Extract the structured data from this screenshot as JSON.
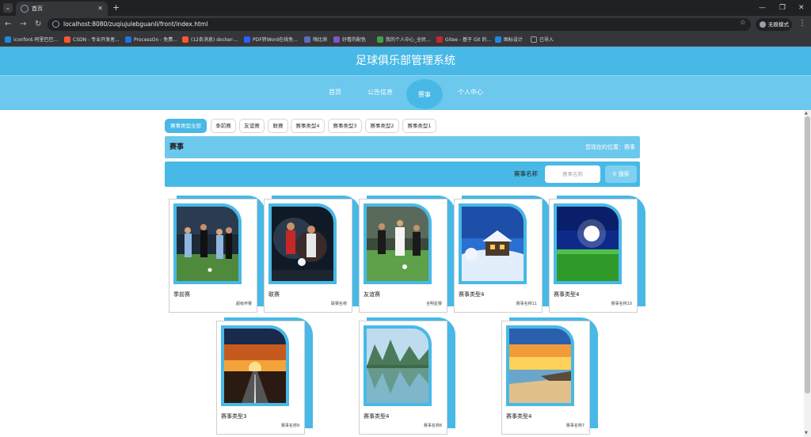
{
  "browser": {
    "tab_title": "首页",
    "url": "localhost:8080/zuqiujulebguanli/front/index.html",
    "incognito_label": "无痕模式",
    "bookmarks": [
      {
        "label": "iconfont-阿里巴巴...",
        "color": "#1e88e5"
      },
      {
        "label": "CSDN - 专业开发者...",
        "color": "#fc5531"
      },
      {
        "label": "ProcessOn - 免费...",
        "color": "#1a73e8"
      },
      {
        "label": "(12条消息) docker-...",
        "color": "#fc5531"
      },
      {
        "label": "PDF转Word在线免...",
        "color": "#2962ff"
      },
      {
        "label": "嗨比测",
        "color": "#5c6bc0"
      },
      {
        "label": "好看的配色",
        "color": "#7e57c2"
      },
      {
        "label": "我的个人中心_全民...",
        "color": "#43a047"
      },
      {
        "label": "Gitee - 基于 Git 的...",
        "color": "#c62828"
      },
      {
        "label": "图标设计",
        "color": "#1e88e5"
      },
      {
        "label": "已导入",
        "color": "#9aa0a6"
      }
    ]
  },
  "site": {
    "title": "足球俱乐部管理系统",
    "nav": [
      "首页",
      "公告信息",
      "赛事",
      "个人中心"
    ]
  },
  "filters": [
    "赛事类型全部",
    "季前赛",
    "友谊赛",
    "联赛",
    "赛事类型4",
    "赛事类型3",
    "赛事类型2",
    "赛事类型1"
  ],
  "section": {
    "title": "赛事",
    "breadcrumb": "您现在的位置：赛事"
  },
  "search": {
    "label": "赛事名称",
    "placeholder": "赛事名称",
    "button": "搜索"
  },
  "cards": [
    {
      "name": "季前赛",
      "sub": "超级杯赛",
      "image": "soccer-match"
    },
    {
      "name": "联赛",
      "sub": "联赛名称",
      "image": "soccer-action"
    },
    {
      "name": "友谊赛",
      "sub": "全明星赛",
      "image": "soccer-dribble"
    },
    {
      "name": "赛事类型4",
      "sub": "赛事名称11",
      "image": "snow-cabin"
    },
    {
      "name": "赛事类型4",
      "sub": "赛事名称10",
      "image": "green-field-sun"
    },
    {
      "name": "赛事类型3",
      "sub": "赛事名称9",
      "image": "sunset-road"
    },
    {
      "name": "赛事类型4",
      "sub": "赛事名称8",
      "image": "lake-mountains"
    },
    {
      "name": "赛事类型4",
      "sub": "赛事名称7",
      "image": "beach-sunset"
    }
  ],
  "colors": {
    "primary": "#48b9e6",
    "nav": "#6cc8ec"
  }
}
